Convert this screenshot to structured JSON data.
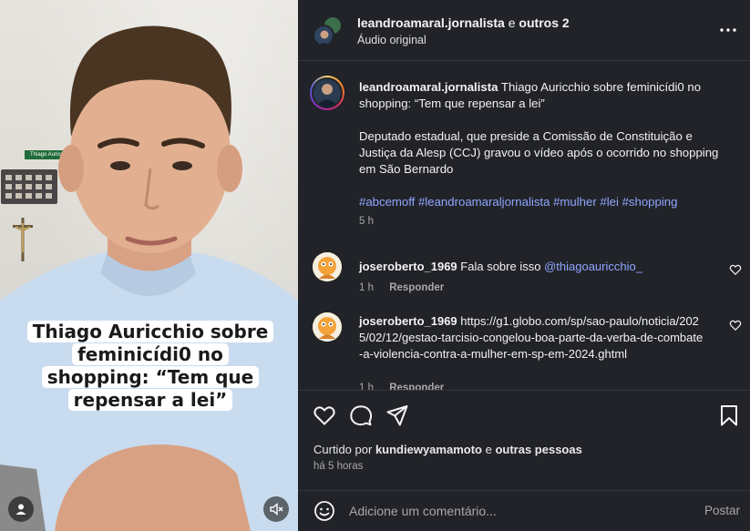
{
  "video": {
    "caption_lines": [
      "Thiago Auricchio sobre",
      "feminicídi0 no",
      "shopping: “Tem que",
      "repensar a lei”"
    ],
    "door_sign": "Thiago Auricc..."
  },
  "header": {
    "username": "leandroamaral.jornalista",
    "joiner": "e",
    "others": "outros 2",
    "audio": "Áudio original"
  },
  "post": {
    "username": "leandroamaral.jornalista",
    "title": "Thiago Auricchio sobre feminicídi0 no shopping: “Tem que repensar a lei”",
    "body": "Deputado estadual, que preside a Comissão de Constituição e Justiça da Alesp (CCJ) gravou o vídeo após o ocorrido no shopping em São Bernardo",
    "hashtags": "#abcemoff #leandroamaraljornalista #mulher #lei #shopping",
    "time": "5 h"
  },
  "comments": [
    {
      "username": "joseroberto_1969",
      "text": "Fala sobre isso",
      "mention": "@thiagoauricchio_",
      "time": "1 h",
      "reply": "Responder"
    },
    {
      "username": "joseroberto_1969",
      "text": "https://g1.globo.com/sp/sao-paulo/noticia/2025/02/12/gestao-tarcisio-congelou-boa-parte-da-verba-de-combate-a-violencia-contra-a-mulher-em-sp-em-2024.ghtml",
      "mention": "",
      "time": "1 h",
      "reply": "Responder"
    }
  ],
  "likes": {
    "prefix": "Curtido por",
    "user": "kundiewyamamoto",
    "joiner": "e",
    "others": "outras pessoas",
    "time": "há 5 horas"
  },
  "comment_bar": {
    "placeholder": "Adicione um comentário...",
    "post_label": "Postar"
  },
  "icons": {
    "more": "more-horizontal-icon",
    "like": "heart-icon",
    "comment": "comment-icon",
    "share": "share-icon",
    "save": "bookmark-icon",
    "emoji": "emoji-icon",
    "mute": "muted-speaker-icon",
    "profile": "user-icon"
  },
  "colors": {
    "panel_bg": "#212328",
    "link": "#8fa6ff",
    "muted_text": "#a8a8a8"
  }
}
